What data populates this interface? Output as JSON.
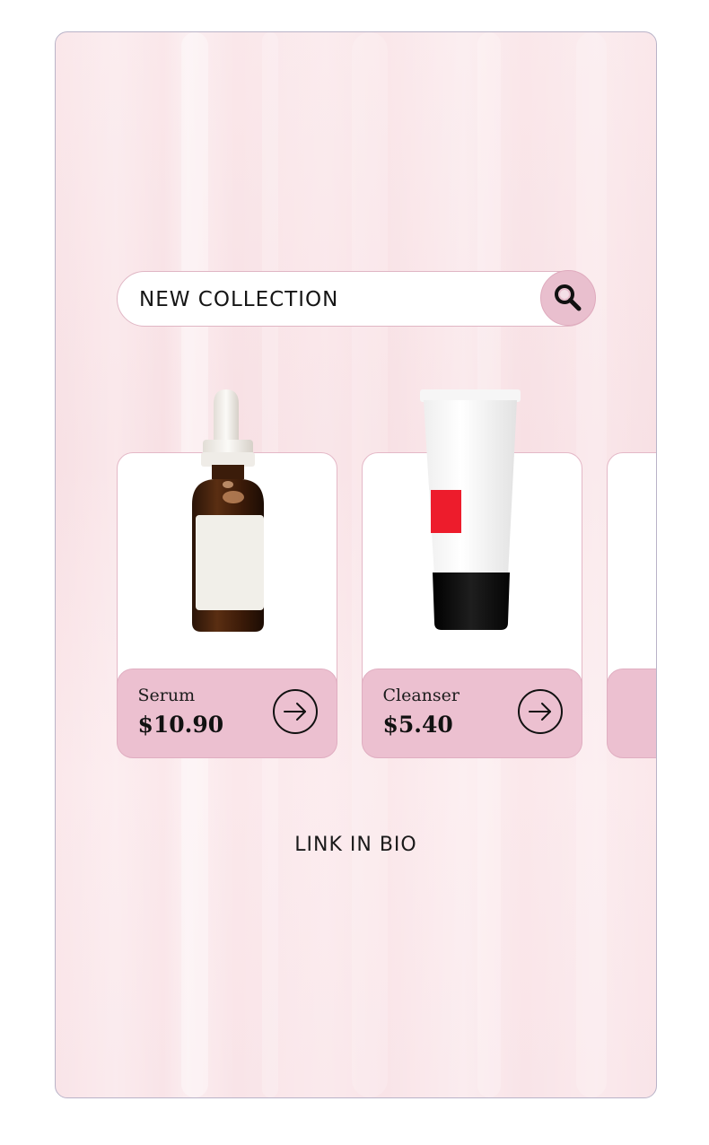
{
  "search": {
    "label": "NEW COLLECTION",
    "icon": "search-icon"
  },
  "products": [
    {
      "name": "Serum",
      "price": "$10.90",
      "icon": "arrow-right-icon"
    },
    {
      "name": "Cleanser",
      "price": "$5.40",
      "icon": "arrow-right-icon"
    }
  ],
  "footer": {
    "link_text": "LINK IN BIO"
  },
  "colors": {
    "accent": "#ecc0d0",
    "background": "#f9e4e8",
    "text": "#111111"
  }
}
